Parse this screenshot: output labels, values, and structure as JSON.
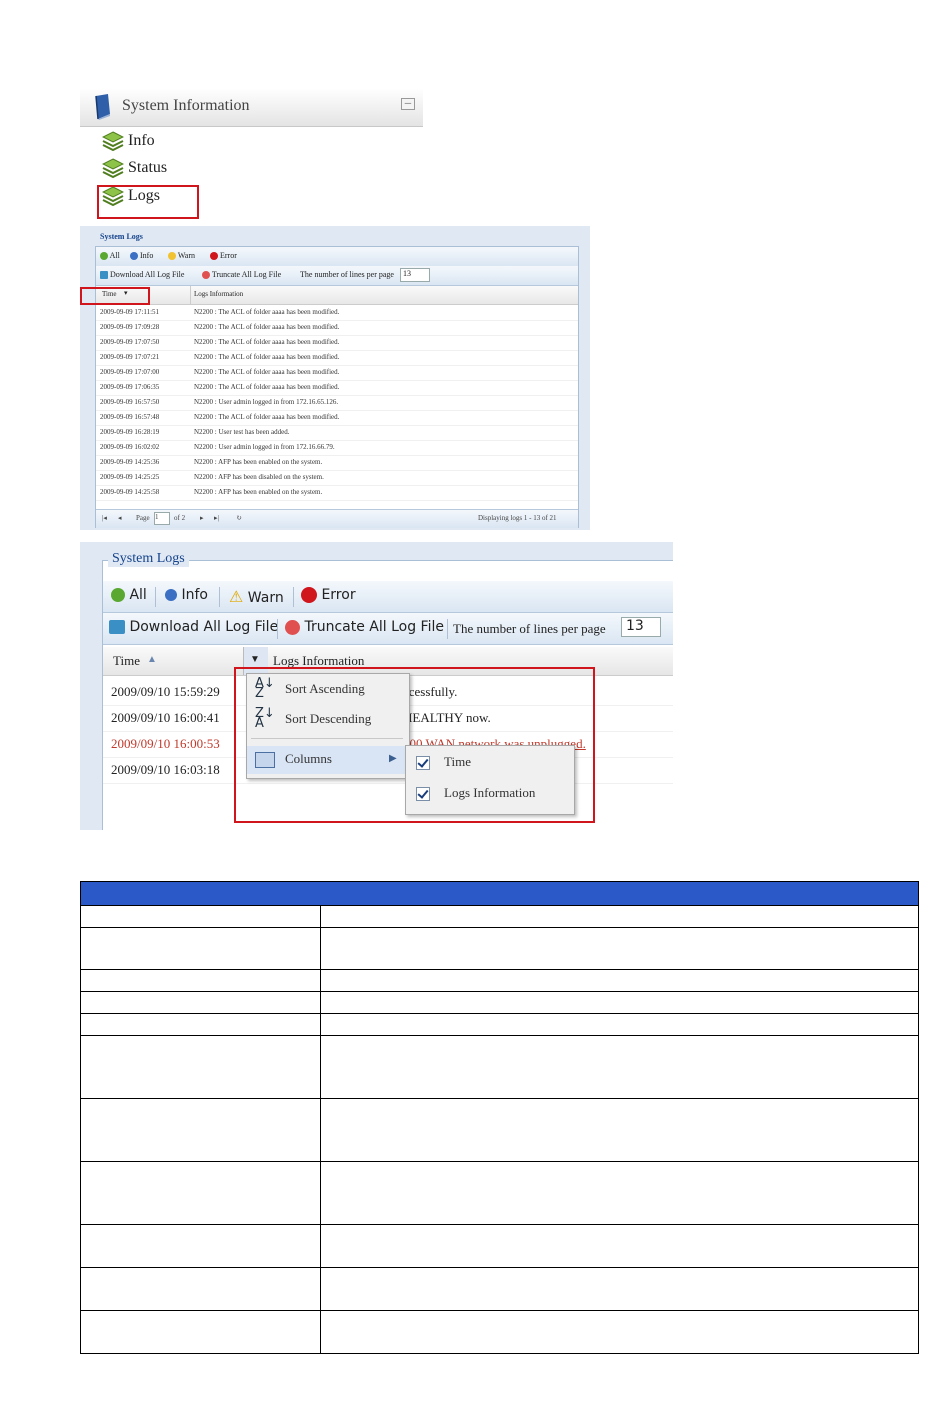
{
  "system_information": {
    "title": "System Information",
    "collapse_glyph": "─",
    "items": [
      {
        "label": "Info"
      },
      {
        "label": "Status"
      },
      {
        "label": "Logs"
      }
    ]
  },
  "system_logs_small": {
    "legend": "System Logs",
    "filters": {
      "all": "All",
      "info": "Info",
      "warn": "Warn",
      "error": "Error"
    },
    "download": "Download All Log File",
    "truncate": "Truncate All Log File",
    "lines_label": "The number of lines per page",
    "lines_value": "13",
    "col_time": "Time",
    "col_info": "Logs Information",
    "rows": [
      {
        "time": "2009-09-09 17:11:51",
        "msg": "N2200 : The ACL of folder aaaa has been modified."
      },
      {
        "time": "2009-09-09 17:09:28",
        "msg": "N2200 : The ACL of folder aaaa has been modified."
      },
      {
        "time": "2009-09-09 17:07:50",
        "msg": "N2200 : The ACL of folder aaaa has been modified."
      },
      {
        "time": "2009-09-09 17:07:21",
        "msg": "N2200 : The ACL of folder aaaa has been modified."
      },
      {
        "time": "2009-09-09 17:07:00",
        "msg": "N2200 : The ACL of folder aaaa has been modified."
      },
      {
        "time": "2009-09-09 17:06:35",
        "msg": "N2200 : The ACL of folder aaaa has been modified."
      },
      {
        "time": "2009-09-09 16:57:50",
        "msg": "N2200 : User admin logged in from 172.16.65.126."
      },
      {
        "time": "2009-09-09 16:57:48",
        "msg": "N2200 : The ACL of folder aaaa has been modified."
      },
      {
        "time": "2009-09-09 16:28:19",
        "msg": "N2200 : User test has been added."
      },
      {
        "time": "2009-09-09 16:02:02",
        "msg": "N2200 : User admin logged in from 172.16.66.79."
      },
      {
        "time": "2009-09-09 14:25:36",
        "msg": "N2200 : AFP has been enabled on the system."
      },
      {
        "time": "2009-09-09 14:25:25",
        "msg": "N2200 : AFP has been disabled on the system."
      },
      {
        "time": "2009-09-09 14:25:58",
        "msg": "N2200 : AFP has been enabled on the system."
      }
    ],
    "pager": {
      "page_label": "Page",
      "page_value": "1",
      "of_label": "of 2",
      "display": "Displaying logs 1 - 13 of 21"
    }
  },
  "system_logs_large": {
    "legend": "System Logs",
    "filters": {
      "all": "All",
      "info": "Info",
      "warn": "Warn",
      "error": "Error"
    },
    "download": "Download All Log File",
    "truncate": "Truncate All Log File",
    "lines_label": "The number of lines per page",
    "lines_value": "13",
    "col_time": "Time",
    "col_info": "Logs Information",
    "rows": [
      {
        "time": "2009/09/10 15:59:29",
        "msg": "ccessfully."
      },
      {
        "time": "2009/09/10 16:00:41",
        "msg": "HEALTHY now."
      },
      {
        "time": "2009/09/10 16:00:53",
        "msg": "200 WAN network was unplugged."
      },
      {
        "time": "2009/09/10 16:03:18",
        "msg": ""
      }
    ],
    "menu": {
      "sort_asc": "Sort Ascending",
      "sort_desc": "Sort Descending",
      "columns": "Columns"
    },
    "submenu": {
      "time": "Time",
      "logs_info": "Logs Information"
    }
  },
  "colors": {
    "highlight": "#d0151c",
    "table_header": "#2c59c8",
    "error_row": "#c0392b"
  }
}
